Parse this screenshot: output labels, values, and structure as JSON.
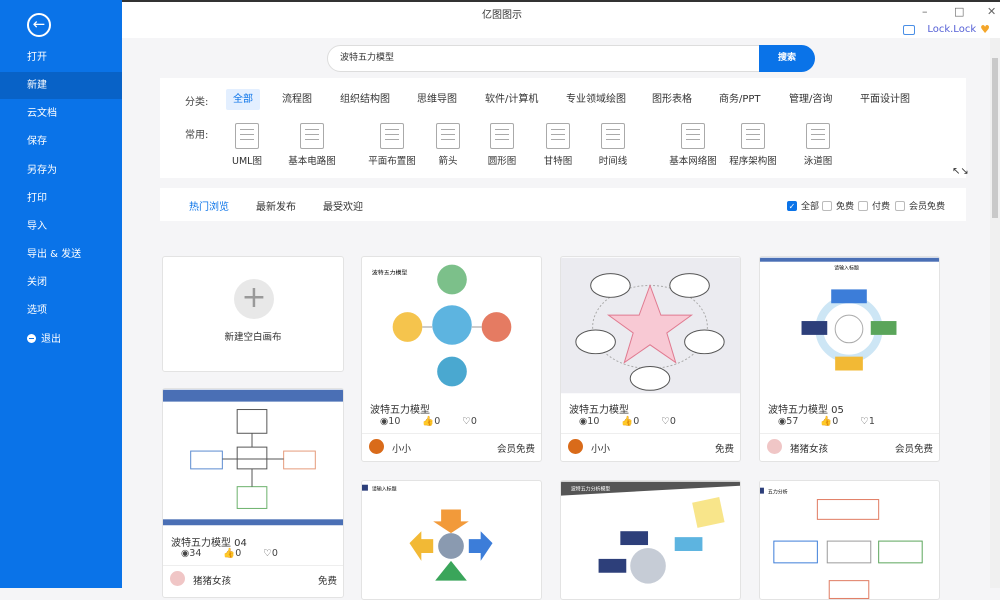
{
  "app": {
    "title": "亿图图示",
    "user": "Lock.Lock",
    "accent": "#0a73e8"
  },
  "sidebar": {
    "back_icon": "arrow-left-circle-icon",
    "items": [
      {
        "label": "打开"
      },
      {
        "label": "新建",
        "active": true
      },
      {
        "label": "云文档"
      },
      {
        "label": "保存"
      },
      {
        "label": "另存为"
      },
      {
        "label": "打印"
      },
      {
        "label": "导入"
      },
      {
        "label": "导出 & 发送"
      },
      {
        "label": "关闭"
      },
      {
        "label": "选项"
      },
      {
        "label": "退出"
      }
    ]
  },
  "search": {
    "value": "波特五力模型",
    "button": "搜索"
  },
  "categories": {
    "label": "分类:",
    "items": [
      "全部",
      "流程图",
      "组织结构图",
      "思维导图",
      "软件/计算机",
      "专业领域绘图",
      "图形表格",
      "商务/PPT",
      "管理/咨询",
      "平面设计图"
    ],
    "active": "全部"
  },
  "common": {
    "label": "常用:",
    "items": [
      "UML图",
      "基本电路图",
      "平面布置图",
      "箭头",
      "圆形图",
      "甘特图",
      "时间线",
      "基本网络图",
      "程序架构图",
      "泳道图"
    ]
  },
  "tabs": {
    "items": [
      "热门浏览",
      "最新发布",
      "最受欢迎"
    ],
    "active": "热门浏览"
  },
  "filters": [
    {
      "label": "全部",
      "checked": true
    },
    {
      "label": "免费",
      "checked": false
    },
    {
      "label": "付费",
      "checked": false
    },
    {
      "label": "会员免费",
      "checked": false
    }
  ],
  "blank": {
    "label": "新建空白画布"
  },
  "cards": [
    {
      "title": "波特五力模型",
      "views": "10",
      "likes": "0",
      "favs": "0",
      "author": "小小",
      "price": "会员免费"
    },
    {
      "title": "波特五力模型",
      "views": "10",
      "likes": "0",
      "favs": "0",
      "author": "小小",
      "price": "免费"
    },
    {
      "title": "波特五力模型 05",
      "views": "57",
      "likes": "0",
      "favs": "1",
      "author": "猪猪女孩",
      "price": "会员免费"
    },
    {
      "title": "波特五力模型 04",
      "views": "34",
      "likes": "0",
      "favs": "0",
      "author": "猪猪女孩",
      "price": "免费"
    }
  ]
}
